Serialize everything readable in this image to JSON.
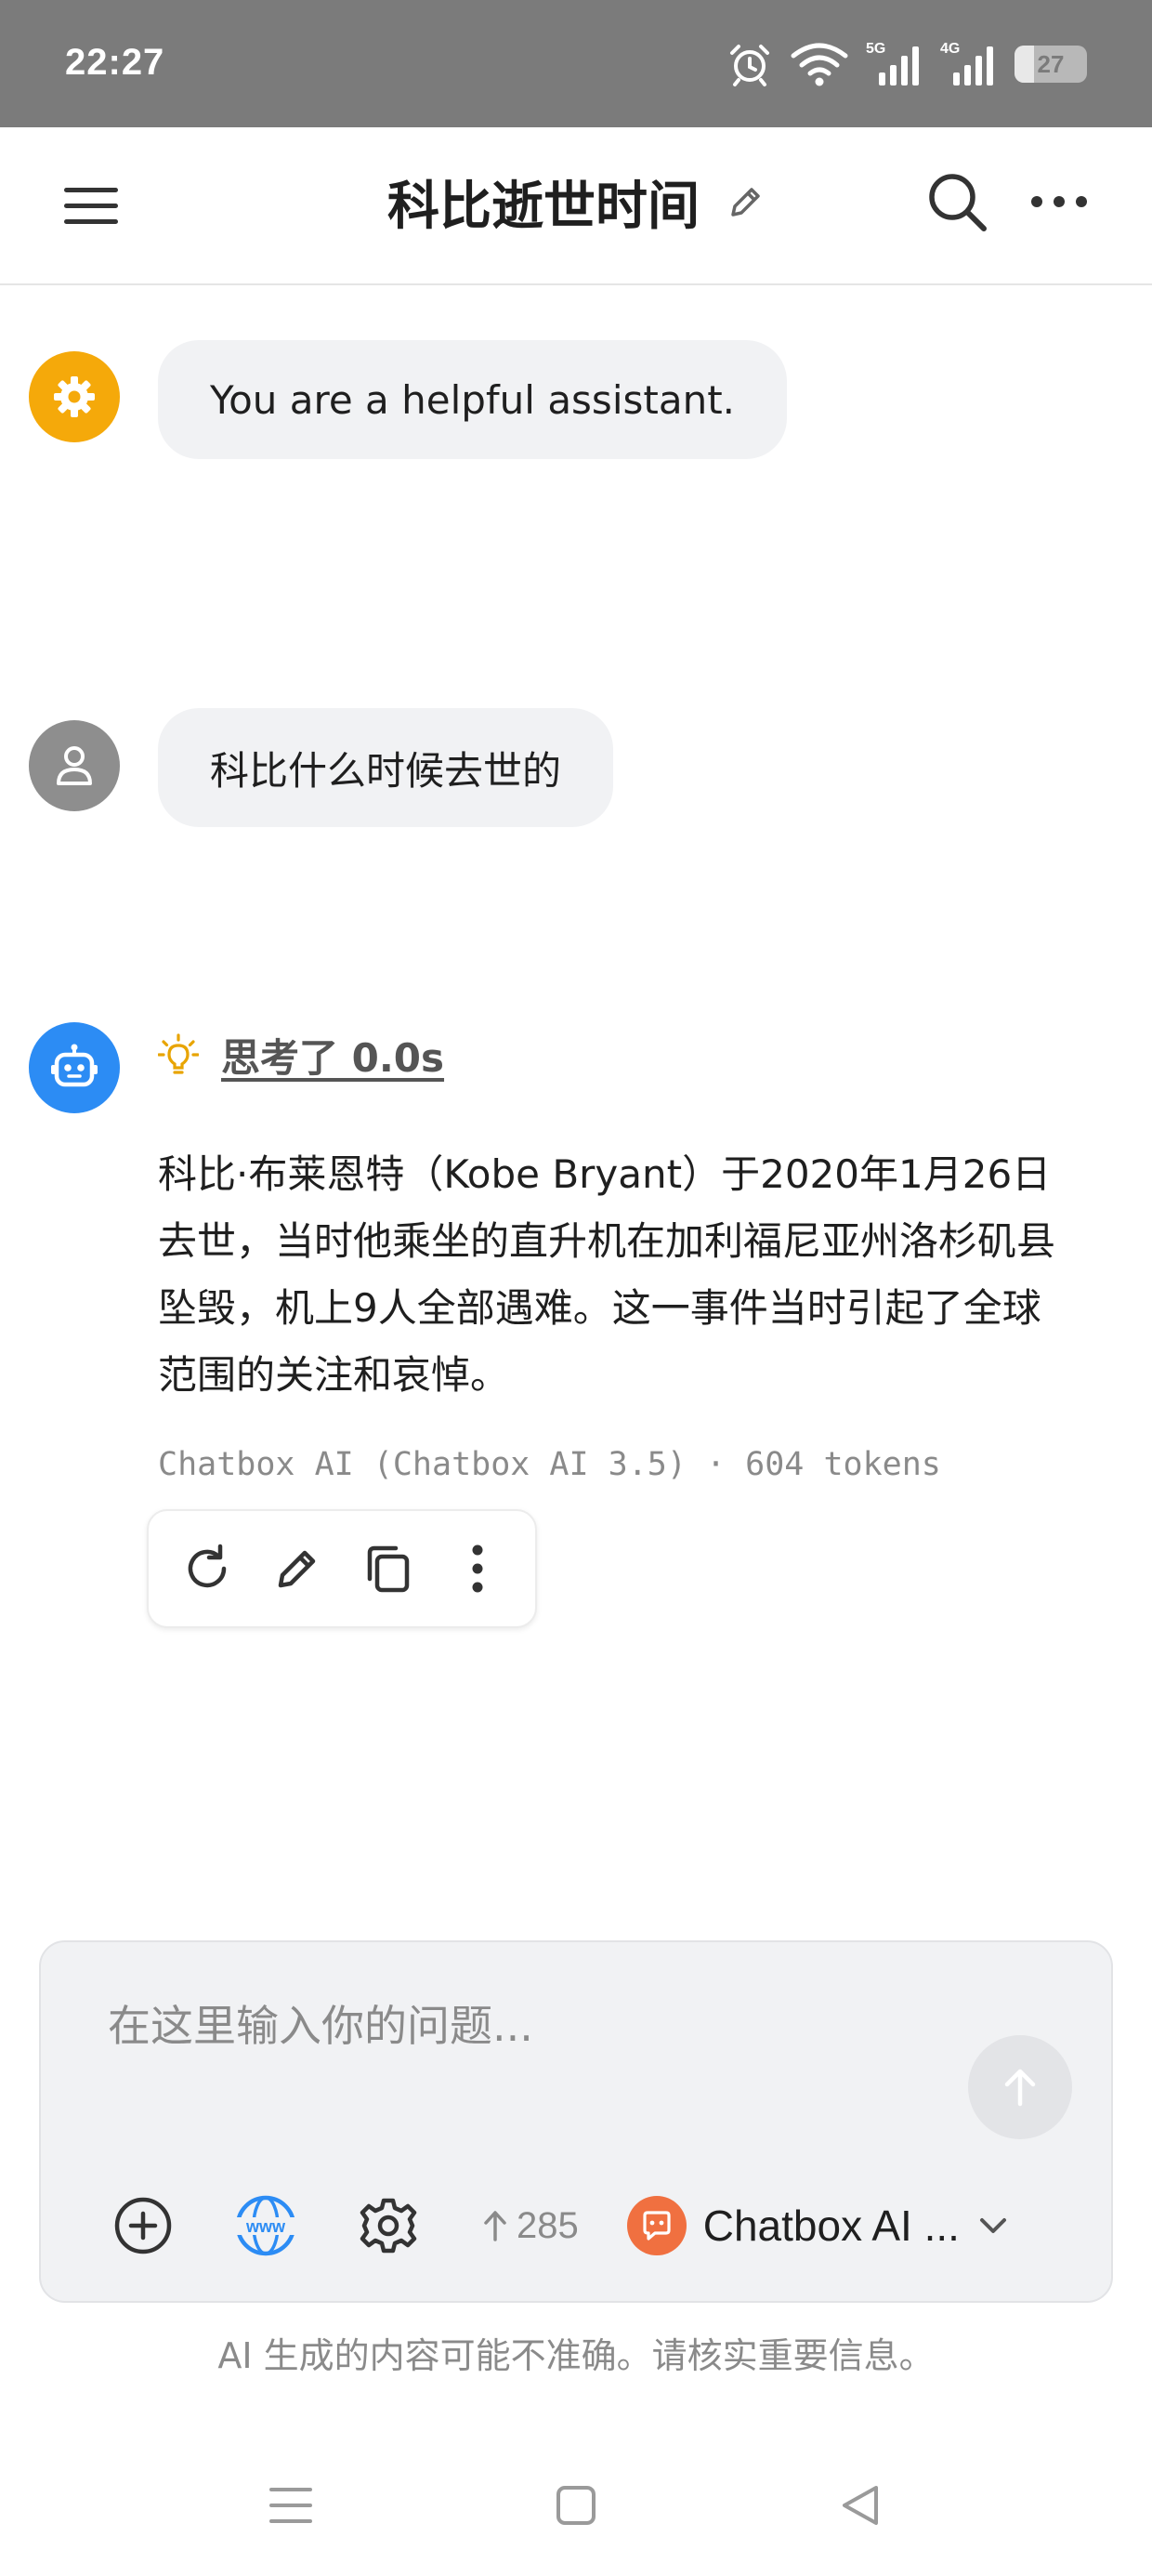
{
  "status_bar": {
    "time": "22:27",
    "signal_1_label": "5G",
    "signal_2_label": "4G",
    "battery_level": "27",
    "battery_fraction": 0.27
  },
  "header": {
    "title": "科比逝世时间",
    "icons": [
      "menu-icon",
      "edit-icon",
      "search-icon",
      "more-icon"
    ]
  },
  "messages": [
    {
      "role": "system",
      "avatar_icon": "gear-icon",
      "avatar_color": "#F5A90A",
      "text": "You are a helpful assistant."
    },
    {
      "role": "user",
      "avatar_icon": "user-icon",
      "avatar_color": "#8E8E8E",
      "text": "科比什么时候去世的"
    },
    {
      "role": "assistant",
      "avatar_icon": "robot-icon",
      "avatar_color": "#2C8CF4",
      "thinking_label": "思考了 0.0s",
      "text": "科比·布莱恩特（Kobe Bryant）于2020年1月26日去世，当时他乘坐的直升机在加利福尼亚州洛杉矶县坠毁，机上9人全部遇难。这一事件当时引起了全球范围的关注和哀悼。",
      "meta": "Chatbox AI (Chatbox AI 3.5) · 604 tokens",
      "actions": [
        "refresh-icon",
        "edit-icon",
        "copy-icon",
        "more-vertical-icon"
      ]
    }
  ],
  "composer": {
    "placeholder": "在这里输入你的问题...",
    "token_count": "285",
    "model_name": "Chatbox AI ...",
    "model_icon_color": "#F07040"
  },
  "disclaimer": "AI 生成的内容可能不准确。请核实重要信息。",
  "nav_bar": {
    "icons": [
      "recents-icon",
      "home-icon",
      "back-icon"
    ]
  }
}
